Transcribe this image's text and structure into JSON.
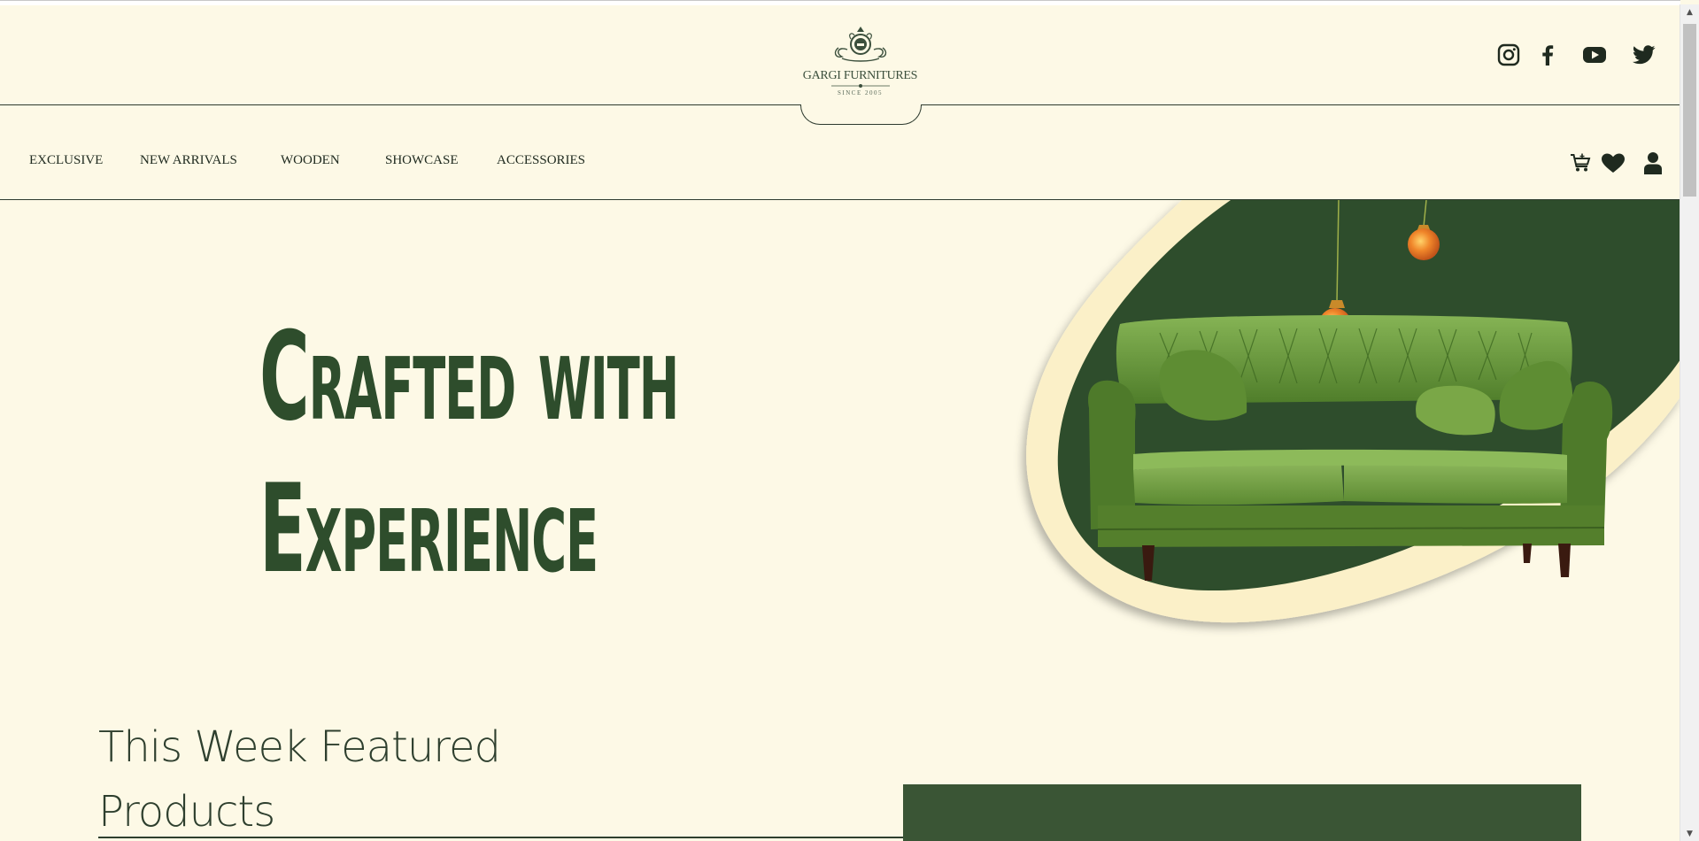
{
  "brand": {
    "name": "GARGI FURNITURES",
    "tagline": "SINCE 2005"
  },
  "socials": [
    {
      "icon": "instagram-icon"
    },
    {
      "icon": "facebook-icon"
    },
    {
      "icon": "youtube-icon"
    },
    {
      "icon": "twitter-icon"
    }
  ],
  "nav": {
    "items": [
      "EXCLUSIVE",
      "NEW ARRIVALS",
      "WOODEN",
      "SHOWCASE",
      "ACCESSORIES"
    ]
  },
  "actions": [
    {
      "icon": "cart-icon"
    },
    {
      "icon": "heart-icon"
    },
    {
      "icon": "user-icon"
    }
  ],
  "hero": {
    "line1": "Crafted with",
    "line2": "Experience"
  },
  "featured": {
    "title": "This Week Featured Products"
  },
  "colors": {
    "background": "#fdf9e6",
    "primary_green": "#2e4d2c",
    "card_green": "#3a5535",
    "sofa_green": "#6f9a3f"
  }
}
